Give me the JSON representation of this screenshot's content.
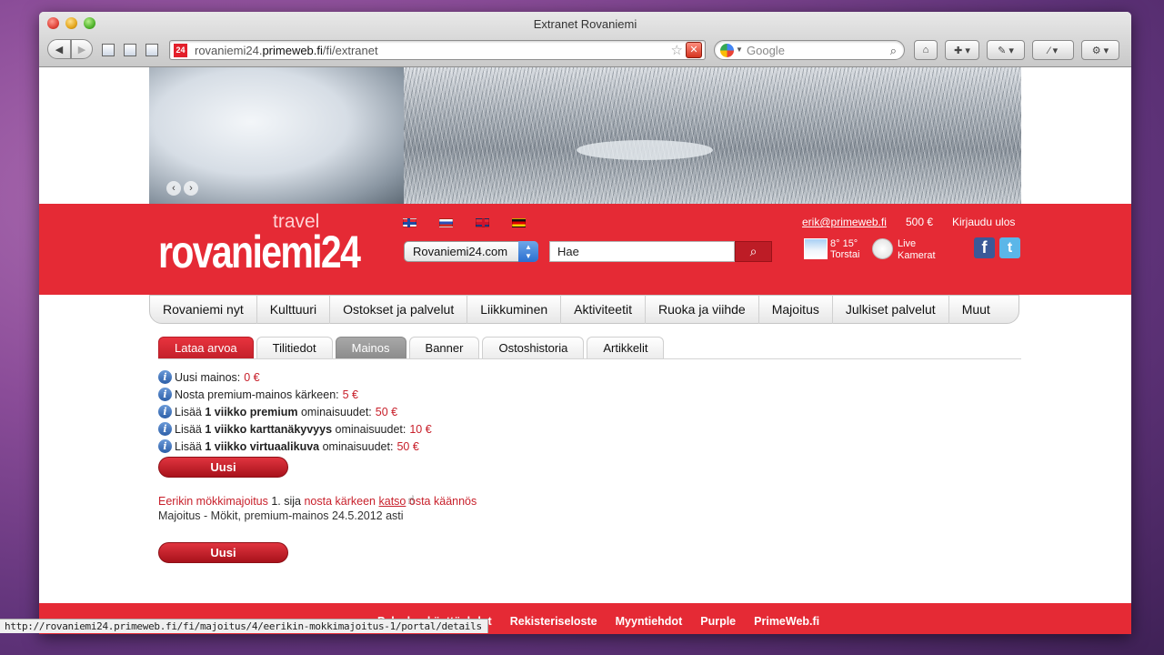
{
  "browser": {
    "window_title": "Extranet Rovaniemi",
    "url_host": "rovaniemi24.",
    "url_domain": "primeweb.fi",
    "url_path": "/fi/extranet",
    "search_placeholder": "Google",
    "favicon_text": "24",
    "status_url": "http://rovaniemi24.primeweb.fi/fi/majoitus/4/eerikin-mokkimajoitus-1/portal/details"
  },
  "header": {
    "logo_main": "rovaniemi24",
    "logo_travel": "travel",
    "site_select_value": "Rovaniemi24.com",
    "search_value": "Hae",
    "account_email": "erik@primeweb.fi",
    "balance": "500 €",
    "logout": "Kirjaudu ulos",
    "weather_temp": "8° 15°",
    "weather_day": "Torstai",
    "cam_line1": "Live",
    "cam_line2": "Kamerat",
    "fb_glyph": "f",
    "tw_glyph": "t"
  },
  "main_nav": [
    "Rovaniemi nyt",
    "Kulttuuri",
    "Ostokset ja palvelut",
    "Liikkuminen",
    "Aktiviteetit",
    "Ruoka ja viihde",
    "Majoitus",
    "Julkiset palvelut",
    "Muut"
  ],
  "tabs": [
    {
      "label": "Lataa arvoa",
      "state": "active"
    },
    {
      "label": "Tilitiedot",
      "state": "normal"
    },
    {
      "label": "Mainos",
      "state": "selected"
    },
    {
      "label": "Banner",
      "state": "normal"
    },
    {
      "label": "Ostoshistoria",
      "state": "normal"
    },
    {
      "label": "Artikkelit",
      "state": "normal"
    }
  ],
  "info": [
    {
      "pre": "Uusi mainos:",
      "bold": "",
      "post": "",
      "price": "0 €"
    },
    {
      "pre": "Nosta premium-mainos kärkeen:",
      "bold": "",
      "post": "",
      "price": "5 €"
    },
    {
      "pre": "Lisää ",
      "bold": "1 viikko premium",
      "post": " ominaisuudet:",
      "price": "50 €"
    },
    {
      "pre": "Lisää ",
      "bold": "1 viikko karttanäkyvyys",
      "post": " ominaisuudet:",
      "price": "10 €"
    },
    {
      "pre": "Lisää ",
      "bold": "1 viikko virtuaalikuva",
      "post": " ominaisuudet:",
      "price": "50 €"
    }
  ],
  "new_button": "Uusi",
  "listing": {
    "name": "Eerikin mökkimajoitus",
    "rank": " 1. sija ",
    "raise": "nosta kärkeen",
    "view": "katso",
    "buy": "osta",
    "translate": "käännös",
    "subtitle": "Majoitus - Mökit, premium-mainos 24.5.2012 asti"
  },
  "footer_links": [
    "Palvelun käyttöehdot",
    "Rekisteriseloste",
    "Myyntiehdot",
    "Purple",
    "PrimeWeb.fi"
  ]
}
